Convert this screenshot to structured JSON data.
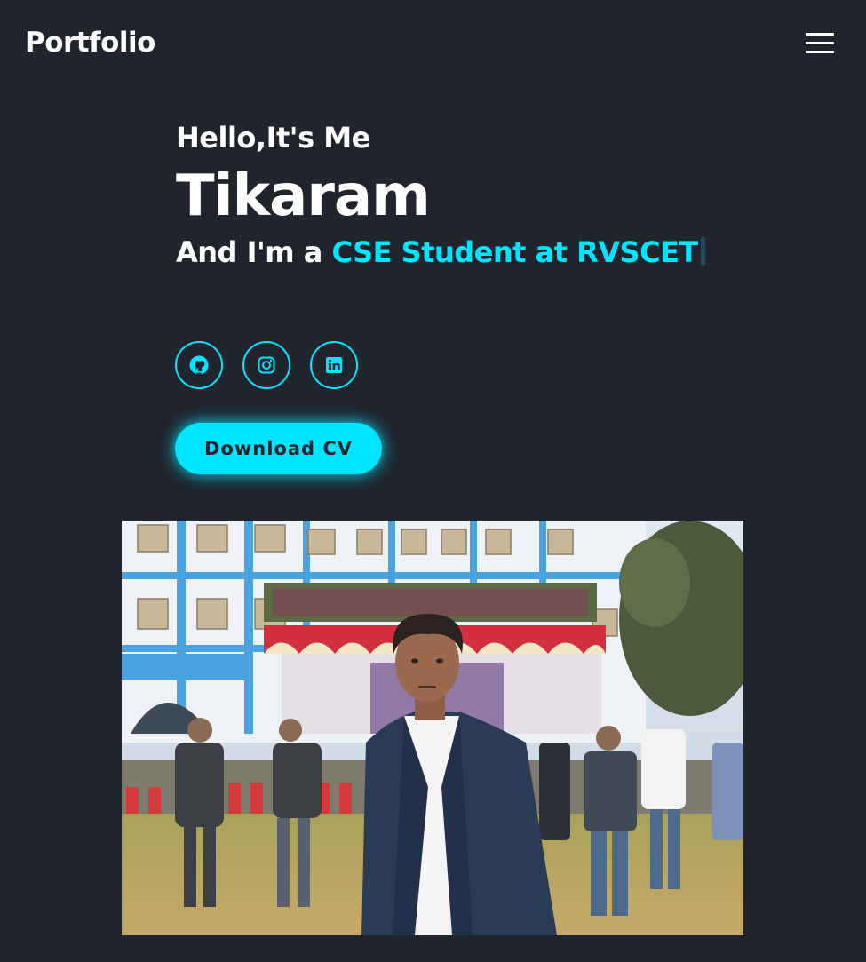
{
  "header": {
    "logo": "Portfolio",
    "menu_icon": "hamburger-menu-icon"
  },
  "hero": {
    "greeting": "Hello,It's Me",
    "name": "Tikaram",
    "role_prefix": "And I'm a ",
    "role_highlight": "CSE Student at RVSCET"
  },
  "social": {
    "items": [
      {
        "icon": "github-icon"
      },
      {
        "icon": "instagram-icon"
      },
      {
        "icon": "linkedin-icon"
      }
    ]
  },
  "cta": {
    "download_label": "Download CV"
  },
  "photo": {
    "alt": "Tikaram"
  },
  "colors": {
    "background": "#1f242d",
    "accent": "#00e5ff",
    "text": "#ffffff"
  }
}
